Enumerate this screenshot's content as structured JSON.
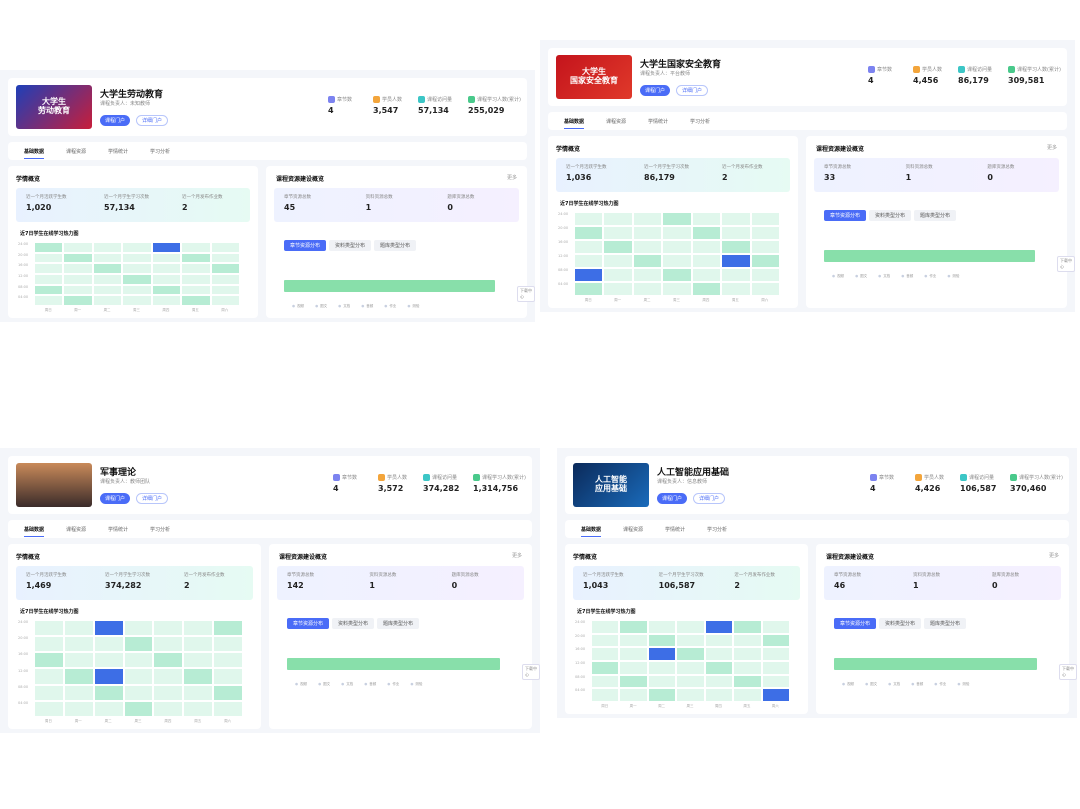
{
  "colors": {
    "accent": "#4a6cf7",
    "heat_hot": "#3d6ee6",
    "heat_mid": "#b7ecd4",
    "heat_low": "#e0f7ec",
    "bar": "#88dfaa"
  },
  "icons": [
    "students-icon",
    "chapters-icon",
    "resources-icon",
    "study-count-icon"
  ],
  "common": {
    "btn_primary": "课程门户",
    "btn_secondary": "详细门户",
    "tabs": [
      "基础数据",
      "课程资源",
      "学情统计",
      "学习分析"
    ],
    "overview_title": "学情概览",
    "resource_title": "课程资源建设概览",
    "more": "更多",
    "heatmap_title": "近7日学生在线学习热力图",
    "resource_tabs": [
      "章节资源分布",
      "资料类型分布",
      "题库类型分布"
    ],
    "download": "下载中心",
    "stat_labels": [
      "章节数",
      "学员人数",
      "课程访问量",
      "课程学习人数(累计)"
    ],
    "band_labels": [
      "近一个月活跃学生数",
      "近一个月学生学习次数",
      "近一个月发布作业数"
    ],
    "resource_labels": [
      "章节资源总数",
      "资料资源总数",
      "题库资源总数"
    ],
    "y_ticks": [
      "24:00",
      "20:00",
      "16:00",
      "12:00",
      "08:00",
      "04:00",
      "00:00"
    ],
    "x_ticks": [
      "周日",
      "周一",
      "周二",
      "周三",
      "周四",
      "周五",
      "周六"
    ],
    "legend": [
      "视频",
      "图文",
      "文档",
      "音频",
      "作业",
      "测验"
    ]
  },
  "courses": [
    {
      "title": "大学生劳动教育",
      "thumb": "大学生\n劳动教育",
      "meta": "课程负责人：未知教师",
      "stats": [
        "4",
        "3,547",
        "57,134",
        "255,029"
      ],
      "band": [
        "1,020",
        "57,134",
        "2"
      ],
      "resources": [
        "45",
        "1",
        "0"
      ]
    },
    {
      "title": "大学生国家安全教育",
      "thumb": "大学生\n国家安全教育",
      "meta": "课程负责人：平台教师",
      "stats": [
        "4",
        "4,456",
        "86,179",
        "309,581"
      ],
      "band": [
        "1,036",
        "86,179",
        "2"
      ],
      "resources": [
        "33",
        "1",
        "0"
      ]
    },
    {
      "title": "军事理论",
      "thumb": "",
      "meta": "课程负责人：教师团队",
      "stats": [
        "4",
        "3,572",
        "374,282",
        "1,314,756"
      ],
      "band": [
        "1,469",
        "374,282",
        "2"
      ],
      "resources": [
        "142",
        "1",
        "0"
      ]
    },
    {
      "title": "人工智能应用基础",
      "thumb": "人工智能\n应用基础",
      "meta": "课程负责人：信息教师",
      "stats": [
        "4",
        "4,426",
        "106,587",
        "370,460"
      ],
      "band": [
        "1,043",
        "106,587",
        "2"
      ],
      "resources": [
        "46",
        "1",
        "0"
      ]
    }
  ]
}
